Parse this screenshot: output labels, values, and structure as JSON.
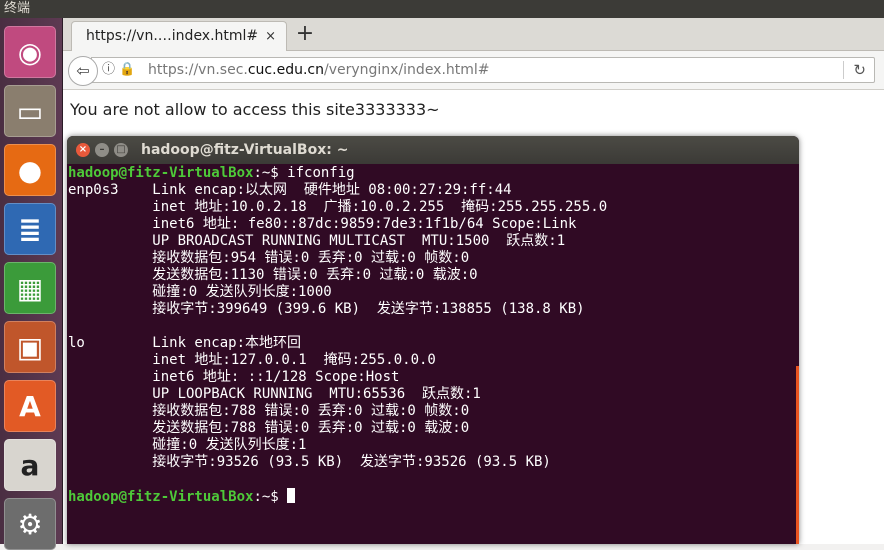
{
  "top_panel": {
    "title": "终端"
  },
  "launcher": {
    "items": [
      {
        "name": "ubuntu-dash",
        "glyph": "◉",
        "color": "#c04a7f"
      },
      {
        "name": "files",
        "glyph": "▭",
        "color": "#8a7e6e"
      },
      {
        "name": "firefox",
        "glyph": "●",
        "color": "#e66a13"
      },
      {
        "name": "writer",
        "glyph": "≣",
        "color": "#2f69b3"
      },
      {
        "name": "calc",
        "glyph": "▦",
        "color": "#3b9b3a"
      },
      {
        "name": "impress",
        "glyph": "▣",
        "color": "#c0562b"
      },
      {
        "name": "software-center",
        "glyph": "A",
        "color": "#e25a25"
      },
      {
        "name": "amazon",
        "glyph": "a",
        "color": "#d8d5cf"
      },
      {
        "name": "system-settings",
        "glyph": "⚙",
        "color": "#6d6d6d"
      }
    ]
  },
  "browser": {
    "tab_label": "https://vn.…index.html#",
    "tab_close": "×",
    "new_tab": "+",
    "back": "⇦",
    "url_prefix": "https://vn.sec.",
    "url_domain": "cuc.edu.cn",
    "url_suffix": "/verynginx/index.html#",
    "security_icons": "ⓘ🔒",
    "reload": "↻",
    "page_text": "You are not allow to access this site3333333~"
  },
  "terminal": {
    "title": "hadoop@fitz-VirtualBox: ~",
    "buttons": {
      "close": "×",
      "minimize": "–",
      "maximize": "□"
    },
    "prompt_user": "hadoop@fitz-VirtualBox",
    "prompt_path": ":~$ ",
    "command": "ifconfig",
    "lines": [
      "enp0s3    Link encap:以太网  硬件地址 08:00:27:29:ff:44",
      "          inet 地址:10.0.2.18  广播:10.0.2.255  掩码:255.255.255.0",
      "          inet6 地址: fe80::87dc:9859:7de3:1f1b/64 Scope:Link",
      "          UP BROADCAST RUNNING MULTICAST  MTU:1500  跃点数:1",
      "          接收数据包:954 错误:0 丢弃:0 过载:0 帧数:0",
      "          发送数据包:1130 错误:0 丢弃:0 过载:0 载波:0",
      "          碰撞:0 发送队列长度:1000",
      "          接收字节:399649 (399.6 KB)  发送字节:138855 (138.8 KB)",
      "",
      "lo        Link encap:本地环回",
      "          inet 地址:127.0.0.1  掩码:255.0.0.0",
      "          inet6 地址: ::1/128 Scope:Host",
      "          UP LOOPBACK RUNNING  MTU:65536  跃点数:1",
      "          接收数据包:788 错误:0 丢弃:0 过载:0 帧数:0",
      "          发送数据包:788 错误:0 丢弃:0 过载:0 载波:0",
      "          碰撞:0 发送队列长度:1",
      "          接收字节:93526 (93.5 KB)  发送字节:93526 (93.5 KB)"
    ]
  }
}
